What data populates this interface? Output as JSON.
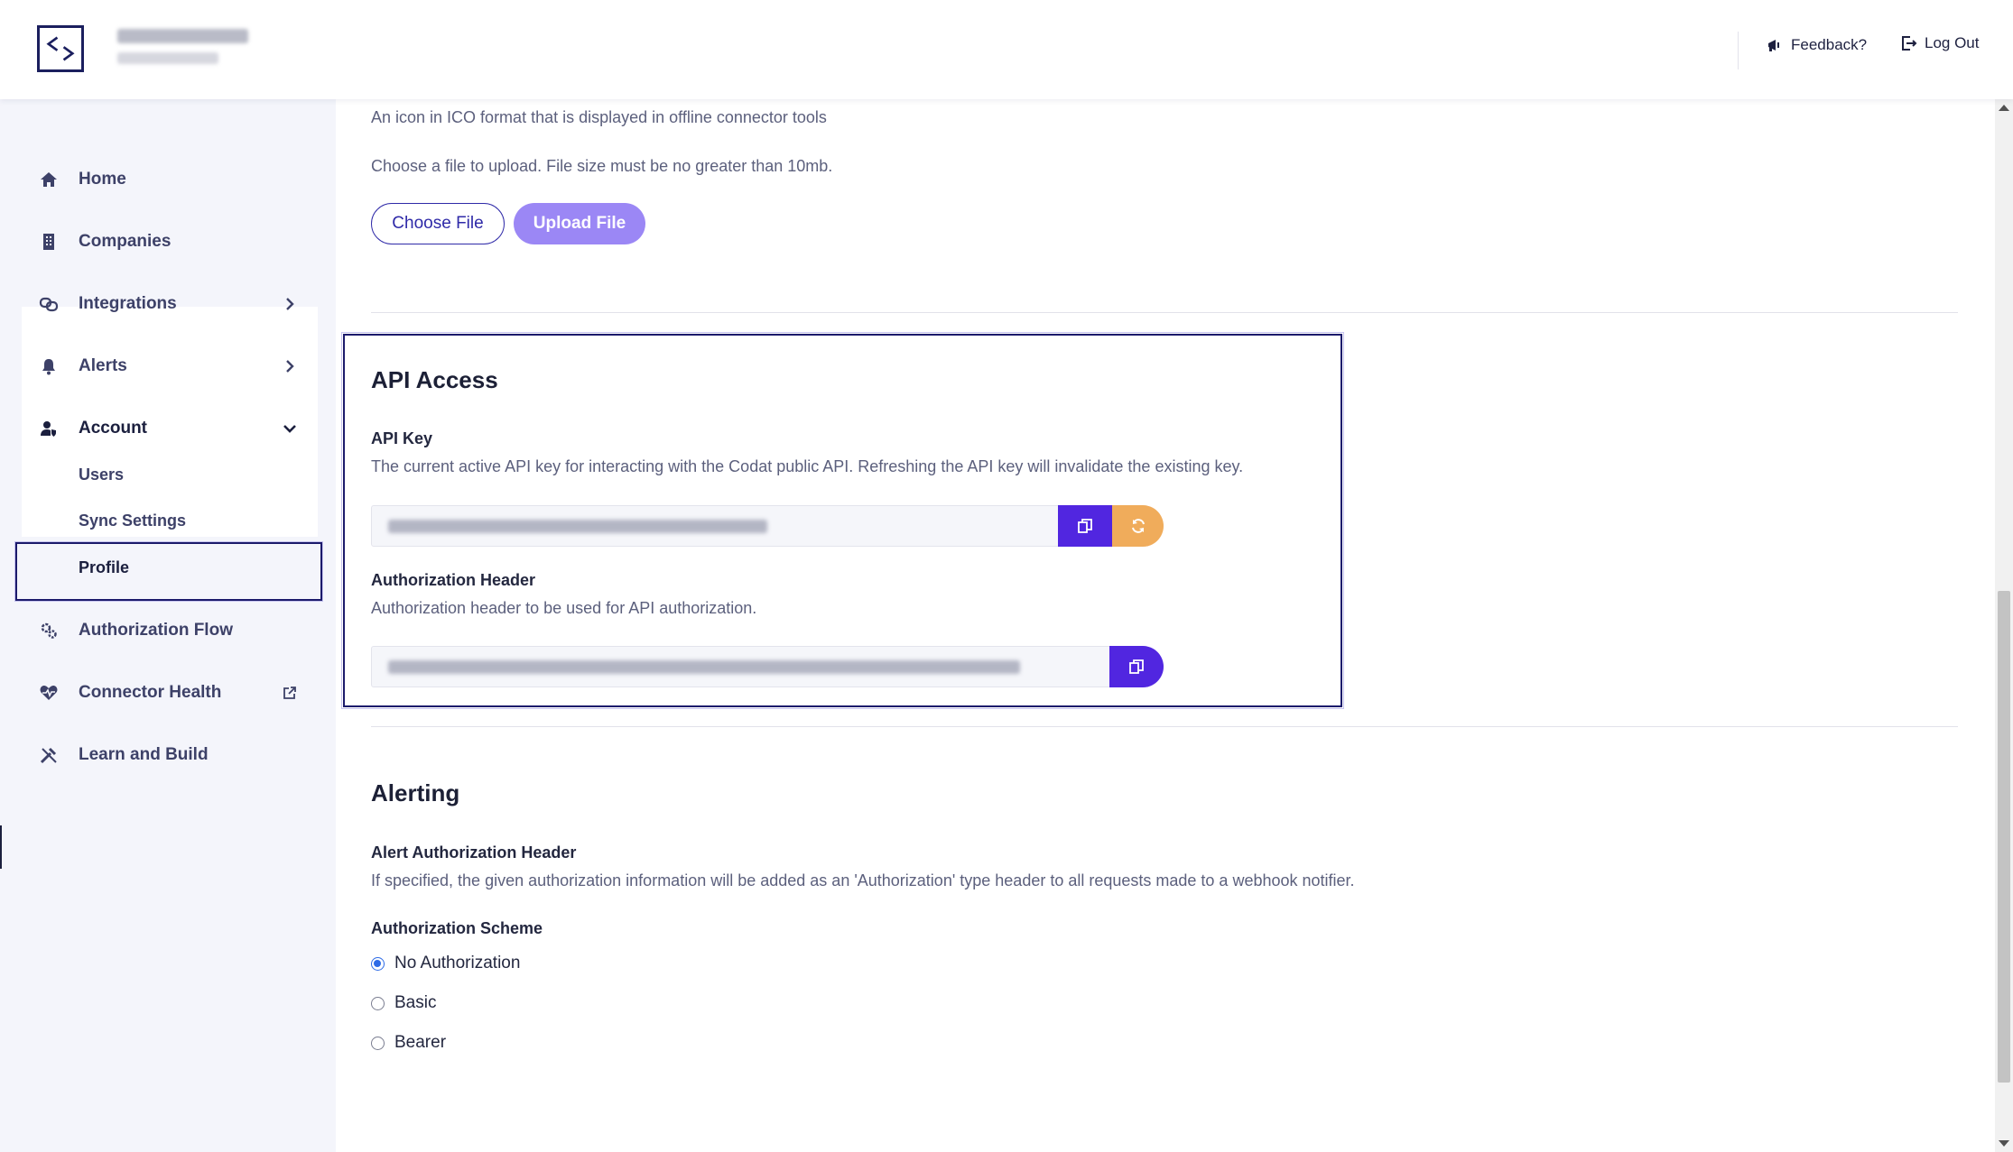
{
  "header": {
    "feedback_label": "Feedback?",
    "logout_label": "Log Out"
  },
  "sidebar": {
    "items": [
      {
        "label": "Home",
        "icon": "home-icon"
      },
      {
        "label": "Companies",
        "icon": "building-icon"
      },
      {
        "label": "Integrations",
        "icon": "link-icon"
      },
      {
        "label": "Alerts",
        "icon": "bell-icon"
      },
      {
        "label": "Account",
        "icon": "user-shield-icon"
      },
      {
        "label": "Authorization Flow",
        "icon": "gears-icon"
      },
      {
        "label": "Connector Health",
        "icon": "heart-pulse-icon"
      },
      {
        "label": "Learn and Build",
        "icon": "tools-icon"
      }
    ],
    "account_subitems": [
      {
        "label": "Users"
      },
      {
        "label": "Sync Settings"
      },
      {
        "label": "Profile"
      }
    ]
  },
  "icon_upload": {
    "description": "An icon in ICO format that is displayed in offline connector tools",
    "instructions": "Choose a file to upload. File size must be no greater than 10mb.",
    "choose_label": "Choose File",
    "upload_label": "Upload File"
  },
  "api_access": {
    "title": "API Access",
    "api_key_label": "API Key",
    "api_key_description": "The current active API key for interacting with the Codat public API. Refreshing the API key will invalidate the existing key.",
    "auth_header_label": "Authorization Header",
    "auth_header_description": "Authorization header to be used for API authorization."
  },
  "alerting": {
    "title": "Alerting",
    "alert_header_label": "Alert Authorization Header",
    "alert_header_description": "If specified, the given authorization information will be added as an 'Authorization' type header to all requests made to a webhook notifier.",
    "scheme_label": "Authorization Scheme",
    "options": [
      "No Authorization",
      "Basic",
      "Bearer"
    ],
    "selected": "No Authorization"
  },
  "colors": {
    "primary": "#5126e0",
    "refresh": "#f0ac5b",
    "upload_button": "#9b87f5",
    "focus_outline": "#1b1a6b"
  }
}
